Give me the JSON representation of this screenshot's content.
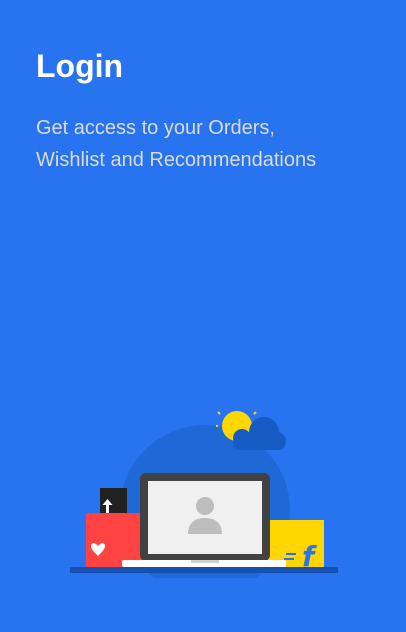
{
  "login_panel": {
    "title": "Login",
    "subtitle_lines": [
      "Get access to your Orders,",
      "Wishlist and Recommendations"
    ]
  },
  "colors": {
    "background": "#2874f0",
    "title_text": "#ffffff",
    "subtitle_text": "#dbdbdb",
    "circle": "#1f68d8",
    "cloud": "#175cc4",
    "sun": "#ffd600",
    "red_box": "#ff4343",
    "yellow_box": "#ffd600",
    "black_box": "#212121",
    "laptop_screen": "#f0f0f0",
    "laptop_frame": "#424242",
    "avatar": "#bdbdbd",
    "ground": "#1650b0"
  },
  "illustration": {
    "icons": [
      "sun-icon",
      "cloud-icon",
      "heart-icon",
      "upload-arrow-icon",
      "user-avatar-icon",
      "flipkart-f-logo"
    ]
  }
}
